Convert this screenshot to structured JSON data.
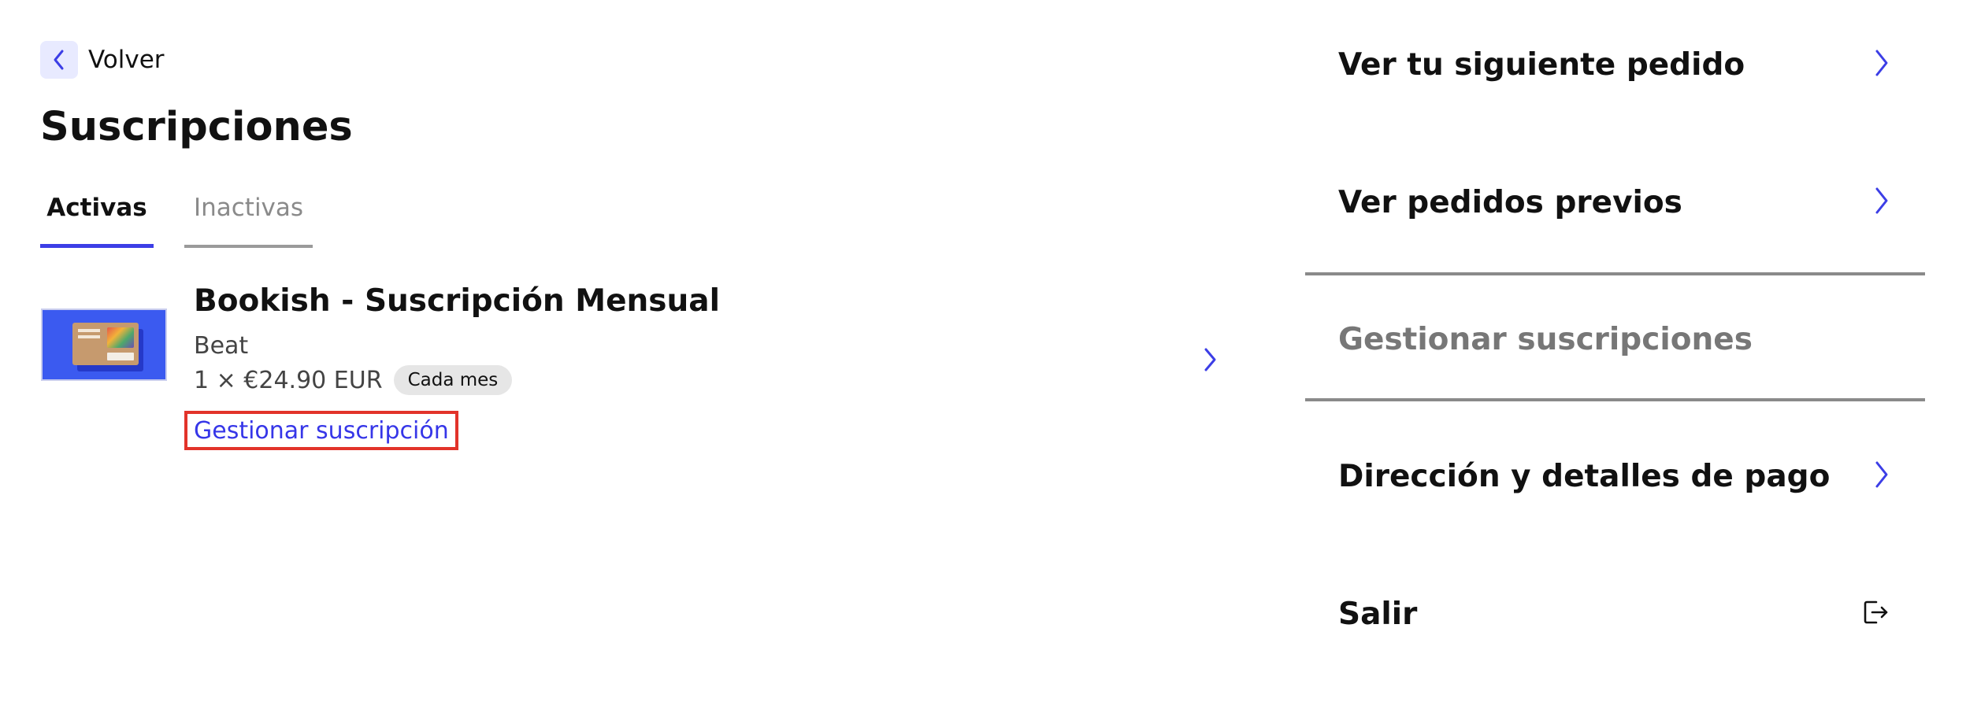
{
  "back": {
    "label": "Volver",
    "icon": "chevron-left-icon"
  },
  "page_title": "Suscripciones",
  "tabs": [
    {
      "label": "Activas",
      "active": true
    },
    {
      "label": "Inactivas",
      "active": false
    }
  ],
  "subscription": {
    "title": "Bookish - Suscripción Mensual",
    "variant": "Beat",
    "price": "1 × €24.90 EUR",
    "frequency": "Cada mes",
    "manage_label": "Gestionar suscripción"
  },
  "menu": {
    "items": [
      {
        "label": "Ver tu siguiente pedido",
        "icon": "chevron-right-icon"
      },
      {
        "label": "Ver pedidos previos",
        "icon": "chevron-right-icon"
      },
      {
        "label": "Gestionar suscripciones",
        "current": true
      },
      {
        "label": "Dirección y detalles de pago",
        "icon": "chevron-right-icon"
      },
      {
        "label": "Salir",
        "icon": "logout-icon"
      }
    ]
  },
  "colors": {
    "accent": "#3c3ee6",
    "link": "#3636e8",
    "highlight_border": "#e2332a",
    "product_bg": "#3b5af0",
    "badge_bg": "#e6e6e6",
    "muted_text": "#777777"
  }
}
